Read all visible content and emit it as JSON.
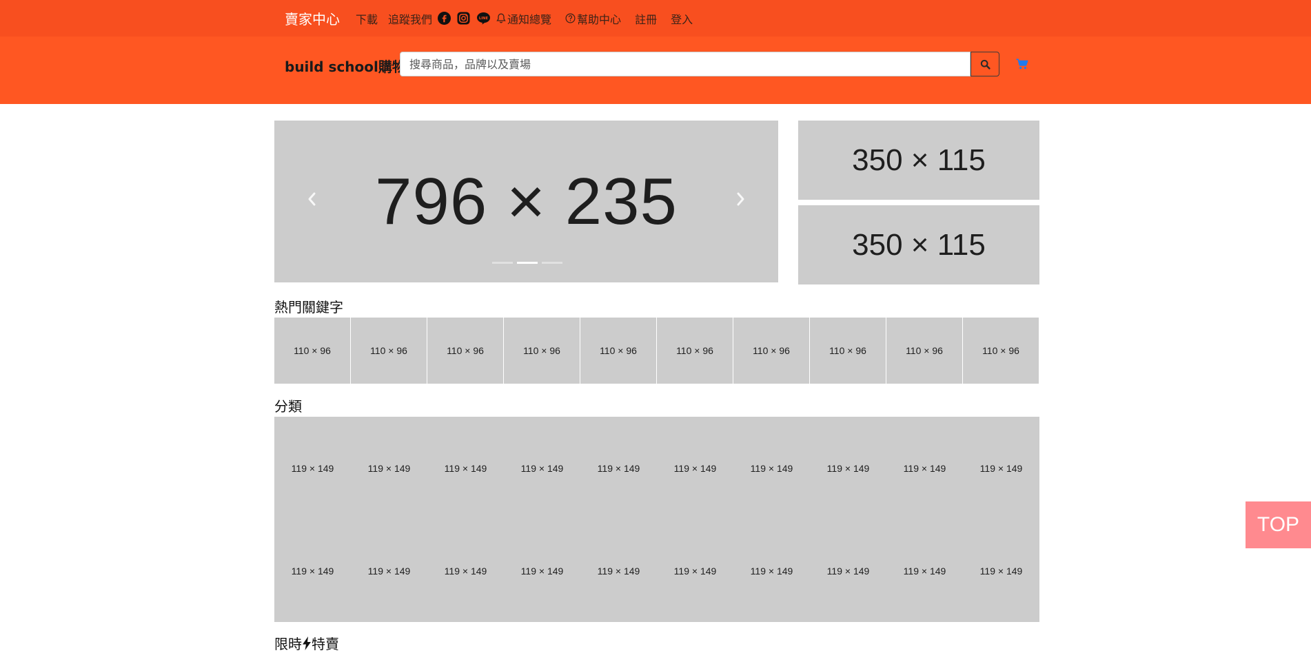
{
  "topnav": {
    "seller_center": "賣家中心",
    "download": "下載",
    "follow_us": "追蹤我們",
    "notifications": "通知總覽",
    "help_center": "幫助中心",
    "register": "註冊",
    "login": "登入"
  },
  "header": {
    "brand": "build school購物",
    "search_placeholder": "搜尋商品，品牌以及賣場"
  },
  "carousel": {
    "label": "796 × 235",
    "slides": 3,
    "active_slide": 2
  },
  "side_banners": [
    "350 × 115",
    "350 × 115"
  ],
  "hot_keywords": {
    "title": "熱門關鍵字",
    "items": [
      "110 × 96",
      "110 × 96",
      "110 × 96",
      "110 × 96",
      "110 × 96",
      "110 × 96",
      "110 × 96",
      "110 × 96",
      "110 × 96",
      "110 × 96"
    ]
  },
  "categories": {
    "title": "分類",
    "rows": [
      [
        "119 × 149",
        "119 × 149",
        "119 × 149",
        "119 × 149",
        "119 × 149",
        "119 × 149",
        "119 × 149",
        "119 × 149",
        "119 × 149",
        "119 × 149"
      ],
      [
        "119 × 149",
        "119 × 149",
        "119 × 149",
        "119 × 149",
        "119 × 149",
        "119 × 149",
        "119 × 149",
        "119 × 149",
        "119 × 149",
        "119 × 149"
      ]
    ]
  },
  "flash_sale": {
    "title_left": "限時",
    "title_right": "特賣"
  },
  "top_button": "TOP",
  "colors": {
    "topbar": "#f84f1f",
    "header": "#ff5722",
    "placeholder": "#cccccc",
    "cart": "#1e7bf0",
    "top_button": "#ff8a8f"
  }
}
